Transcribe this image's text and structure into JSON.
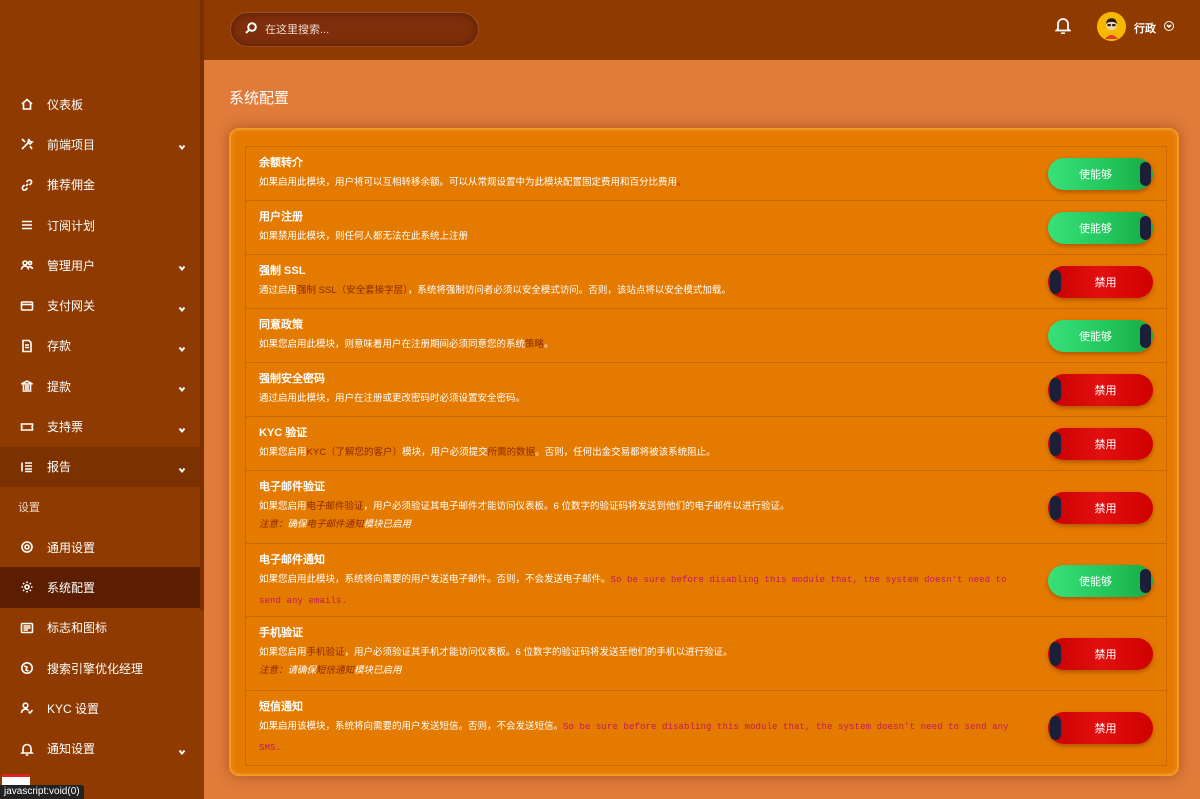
{
  "topbar": {
    "search_placeholder": "在这里搜索...",
    "user_name": "行政"
  },
  "sidebar": {
    "items": [
      {
        "label": "仪表板",
        "icon": "home-icon",
        "chevron": false
      },
      {
        "label": "前端项目",
        "icon": "tools-icon",
        "chevron": true
      },
      {
        "label": "推荐佣金",
        "icon": "link-icon",
        "chevron": false
      },
      {
        "label": "订阅计划",
        "icon": "list-icon",
        "chevron": false
      },
      {
        "label": "管理用户",
        "icon": "users-icon",
        "chevron": true
      },
      {
        "label": "支付网关",
        "icon": "card-icon",
        "chevron": true
      },
      {
        "label": "存款",
        "icon": "deposit-icon",
        "chevron": true
      },
      {
        "label": "提款",
        "icon": "bank-icon",
        "chevron": true
      },
      {
        "label": "支持票",
        "icon": "ticket-icon",
        "chevron": true
      },
      {
        "label": "报告",
        "icon": "report-icon",
        "chevron": true
      }
    ],
    "section_label": "设置",
    "settings_items": [
      {
        "label": "通用设置",
        "icon": "cog-circle-icon",
        "chevron": false
      },
      {
        "label": "系统配置",
        "icon": "gear-icon",
        "chevron": false
      },
      {
        "label": "标志和图标",
        "icon": "image-icon",
        "chevron": false
      },
      {
        "label": "搜索引擎优化经理",
        "icon": "globe-icon",
        "chevron": false
      },
      {
        "label": "KYC 设置",
        "icon": "user-check-icon",
        "chevron": false
      },
      {
        "label": "通知设置",
        "icon": "bell-icon",
        "chevron": true
      }
    ],
    "status_tip": "javascript:void(0)"
  },
  "main": {
    "page_title": "系统配置",
    "rows": [
      {
        "title": "余额转介",
        "desc": [
          {
            "t": "如果启用此模块，用户将可以互相转移余额。可以从常规设置中为此模块配置固定费用和百分比费用"
          },
          {
            "t": "。",
            "hl": true
          }
        ],
        "toggle": "使能够",
        "state": "on"
      },
      {
        "title": "用户注册",
        "desc": [
          {
            "t": "如果禁用此模块，则任何人都无法在此系统上注册"
          }
        ],
        "toggle": "使能够",
        "state": "on"
      },
      {
        "title": "强制 SSL",
        "desc": [
          {
            "t": "通过启用"
          },
          {
            "t": "强制 SSL（安全套接字层）",
            "hl": true
          },
          {
            "t": "，系统将强制访问者必须以安全模式访问。否则，该站点将以安全模式加载。"
          }
        ],
        "toggle": "禁用",
        "state": "off"
      },
      {
        "title": "同意政策",
        "desc": [
          {
            "t": "如果您启用此模块，则意味着用户在注册期间必须同意您的系统"
          },
          {
            "t": "策略",
            "hl": true
          },
          {
            "t": "。"
          }
        ],
        "toggle": "使能够",
        "state": "on"
      },
      {
        "title": "强制安全密码",
        "desc": [
          {
            "t": "通过启用此模块，用户在注册或更改密码时必须设置安全密码。"
          }
        ],
        "toggle": "禁用",
        "state": "off"
      },
      {
        "title": "KYC 验证",
        "desc": [
          {
            "t": "如果您启用"
          },
          {
            "t": "KYC（了解您的客户）",
            "hl": true
          },
          {
            "t": "模块，用户必须提交"
          },
          {
            "t": "所需的数据",
            "hl": true
          },
          {
            "t": "。否则，任何出金交易都将被该系统阻止。"
          }
        ],
        "toggle": "禁用",
        "state": "off"
      },
      {
        "title": "电子邮件验证",
        "desc": [
          {
            "t": "如果您启用"
          },
          {
            "t": "电子邮件验证",
            "hl": true
          },
          {
            "t": "，用户必须验证其电子邮件才能访问仪表板。6 位数字的验证码将发送到他们的电子邮件以进行验证。"
          }
        ],
        "note": [
          {
            "t": "注意：",
            "label": true
          },
          {
            "t": "确保"
          },
          {
            "t": "电子邮件通知",
            "hl": true
          },
          {
            "t": "模块已启用"
          }
        ],
        "toggle": "禁用",
        "state": "off"
      },
      {
        "title": "电子邮件通知",
        "desc": [
          {
            "t": "如果您启用此模块，系统将向需要的用户发送电子邮件。否则，不会发送电子邮件。"
          },
          {
            "t": "So be sure before disabling this module that, the system doesn't need to send any emails.",
            "warn": true
          }
        ],
        "toggle": "使能够",
        "state": "on"
      },
      {
        "title": "手机验证",
        "desc": [
          {
            "t": "如果您启用"
          },
          {
            "t": "手机验证",
            "hl": true
          },
          {
            "t": "，用户必须验证其手机才能访问仪表板。6 位数字的验证码将发送至他们的手机以进行验证。"
          }
        ],
        "note": [
          {
            "t": "注意：",
            "label": true
          },
          {
            "t": "请确保"
          },
          {
            "t": "短信通知",
            "hl": true
          },
          {
            "t": "模块已启用"
          }
        ],
        "toggle": "禁用",
        "state": "off"
      },
      {
        "title": "短信通知",
        "desc": [
          {
            "t": "如果启用该模块，系统将向需要的用户发送短信。否则，不会发送短信。"
          },
          {
            "t": "So be sure before disabling this module that, the system doesn't need to send any SMS.",
            "warn": true
          }
        ],
        "toggle": "禁用",
        "state": "off"
      }
    ]
  },
  "colors": {
    "sidebar_bg": "#8f3a00",
    "content_bg": "#e07b3a",
    "card_bg": "#e57a00",
    "enabled_green": "#22c55a",
    "disabled_red": "#e21010",
    "highlight_text": "#8b2a00",
    "warning_text": "#c2185b"
  }
}
